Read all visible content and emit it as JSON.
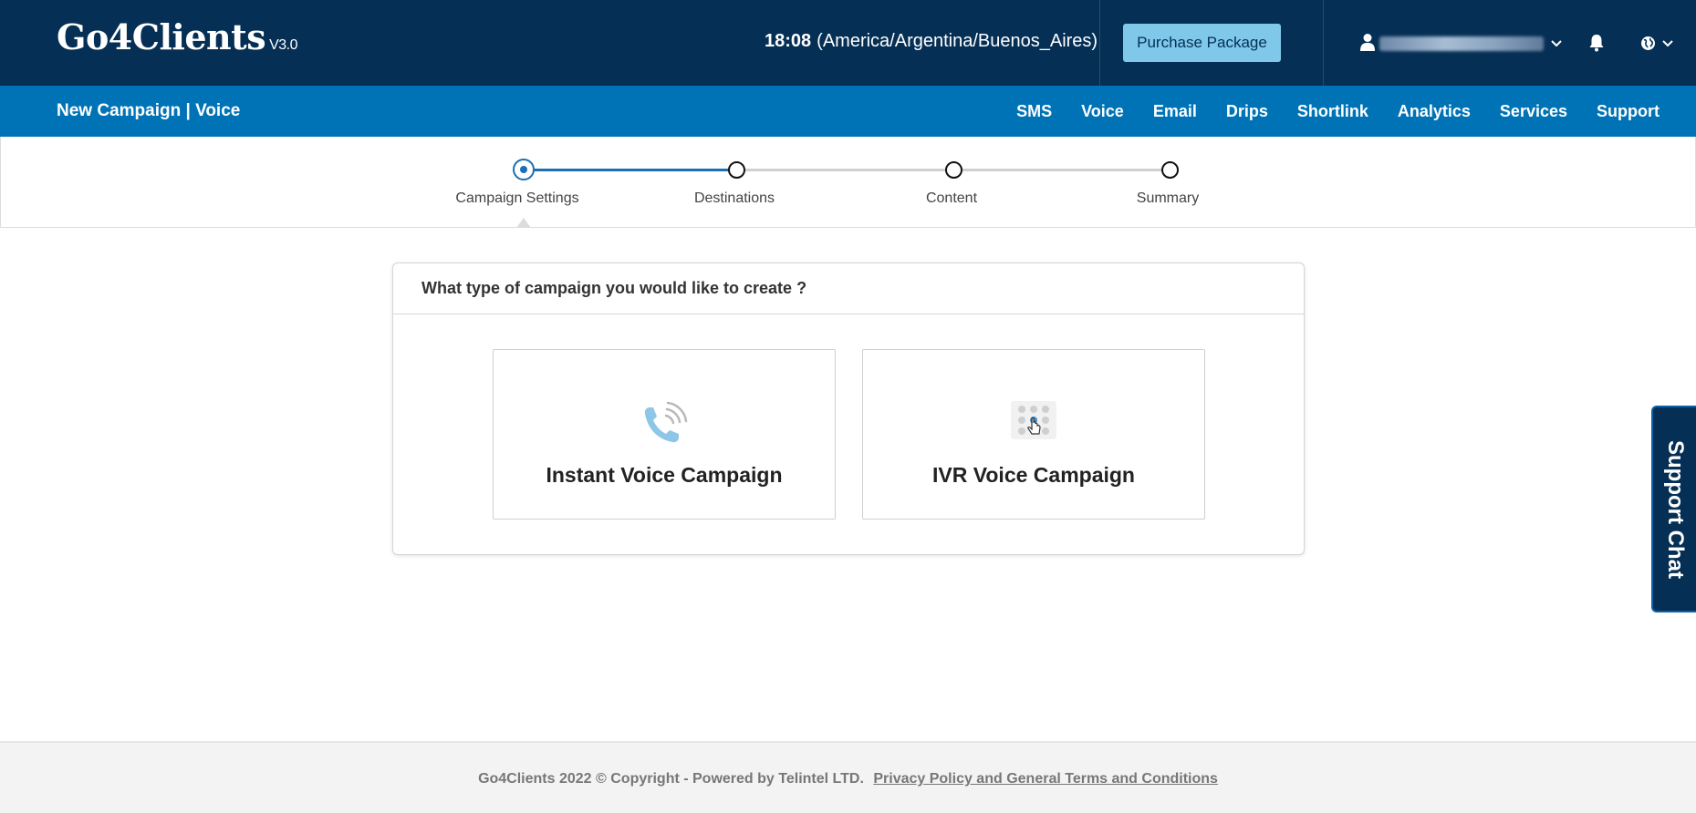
{
  "header": {
    "logo_text": "Go4Clients",
    "logo_version": "V3.0",
    "time": "18:08",
    "timezone": "(America/Argentina/Buenos_Aires)",
    "purchase_label": "Purchase Package",
    "icons": [
      "user-icon",
      "chevron-down-icon",
      "bell-icon",
      "globe-icon"
    ]
  },
  "subnav": {
    "title": "New Campaign | Voice",
    "items": [
      {
        "label": "SMS"
      },
      {
        "label": "Voice"
      },
      {
        "label": "Email"
      },
      {
        "label": "Drips"
      },
      {
        "label": "Shortlink"
      },
      {
        "label": "Analytics"
      },
      {
        "label": "Services"
      },
      {
        "label": "Support"
      }
    ]
  },
  "stepper": {
    "steps": [
      {
        "label": "Campaign Settings",
        "state": "active"
      },
      {
        "label": "Destinations",
        "state": "pending"
      },
      {
        "label": "Content",
        "state": "pending"
      },
      {
        "label": "Summary",
        "state": "pending"
      }
    ]
  },
  "main": {
    "question": "What type of campaign you would like to create ?",
    "cards": [
      {
        "label": "Instant Voice Campaign",
        "icon": "phone-ringing-icon"
      },
      {
        "label": "IVR Voice Campaign",
        "icon": "keypad-touch-icon"
      }
    ]
  },
  "support_chat": {
    "label": "Support Chat"
  },
  "footer": {
    "copyright": "Go4Clients 2022 © Copyright - Powered by Telintel LTD.",
    "link": "Privacy Policy and General Terms and Conditions"
  },
  "colors": {
    "header_bg": "#052f54",
    "subnav_bg": "#0073b6",
    "accent": "#1a6fb5",
    "purchase_bg": "#7fc8ea"
  }
}
